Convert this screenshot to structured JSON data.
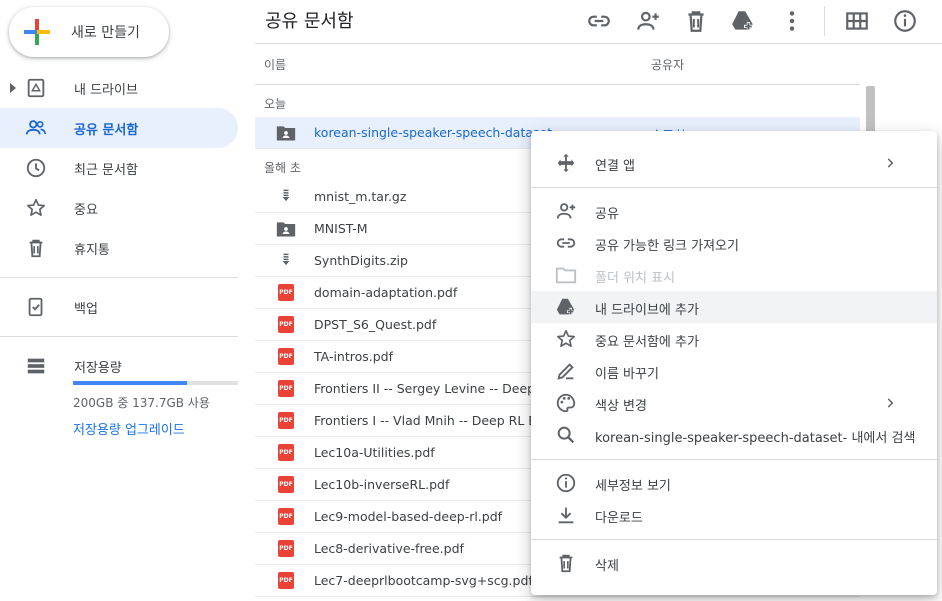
{
  "sidebar": {
    "new_label": "새로 만들기",
    "items": [
      {
        "label": "내 드라이브"
      },
      {
        "label": "공유 문서함"
      },
      {
        "label": "최근 문서함"
      },
      {
        "label": "중요"
      },
      {
        "label": "휴지통"
      },
      {
        "label": "백업"
      },
      {
        "label": "저장용량"
      }
    ],
    "storage": {
      "used_fraction": 0.69,
      "text": "200GB 중 137.7GB 사용",
      "upgrade": "저장용량 업그레이드"
    }
  },
  "header": {
    "title": "공유 문서함"
  },
  "list": {
    "col_name": "이름",
    "col_owner": "공유자",
    "section_today": "오늘",
    "section_year": "올해 초",
    "selected": {
      "name": "korean-single-speaker-speech-dataset",
      "owner": "송주희"
    },
    "files": [
      {
        "name": "mnist_m.tar.gz",
        "type": "archive"
      },
      {
        "name": "MNIST-M",
        "type": "shared-folder"
      },
      {
        "name": "SynthDigits.zip",
        "type": "archive"
      },
      {
        "name": "domain-adaptation.pdf",
        "type": "pdf"
      },
      {
        "name": "DPST_S6_Quest.pdf",
        "type": "pdf"
      },
      {
        "name": "TA-intros.pdf",
        "type": "pdf"
      },
      {
        "name": "Frontiers II -- Sergey Levine -- Deep RL",
        "type": "pdf"
      },
      {
        "name": "Frontiers I -- Vlad Mnih -- Deep RL Boo",
        "type": "pdf"
      },
      {
        "name": "Lec10a-Utilities.pdf",
        "type": "pdf"
      },
      {
        "name": "Lec10b-inverseRL.pdf",
        "type": "pdf"
      },
      {
        "name": "Lec9-model-based-deep-rl.pdf",
        "type": "pdf"
      },
      {
        "name": "Lec8-derivative-free.pdf",
        "type": "pdf"
      },
      {
        "name": "Lec7-deeprlbootcamp-svg+scg.pdf",
        "type": "pdf"
      }
    ],
    "pdf_badge": "PDF"
  },
  "menu": {
    "open_with": "연결 앱",
    "share": "공유",
    "get_link": "공유 가능한 링크 가져오기",
    "show_folder": "폴더 위치 표시",
    "add_to_drive": "내 드라이브에 추가",
    "add_starred": "중요 문서함에 추가",
    "rename": "이름 바꾸기",
    "change_color": "색상 변경",
    "search_within": "korean-single-speaker-speech-dataset- 내에서 검색",
    "details": "세부정보 보기",
    "download": "다운로드",
    "remove": "삭제"
  },
  "colors": {
    "accent": "#1a73e8",
    "selected_bg": "#e8f0fe",
    "pdf_red": "#ea4335"
  }
}
